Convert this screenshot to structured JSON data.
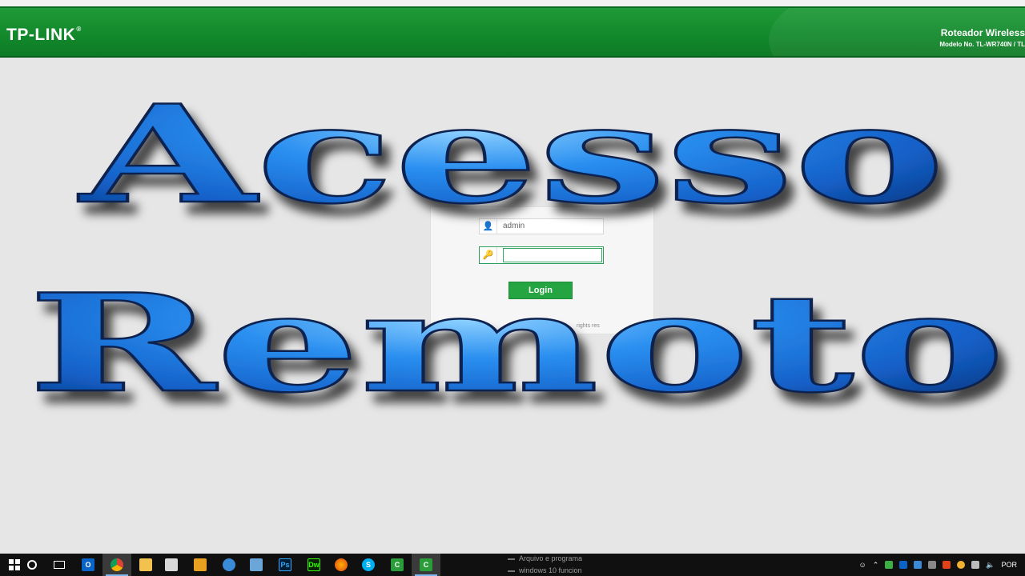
{
  "header": {
    "logo": "TP-LINK",
    "logo_mark": "®",
    "product_name": "Roteador Wireless",
    "model": "Modelo No. TL-WR740N / TL"
  },
  "login": {
    "username_value": "admin",
    "password_value": "",
    "button_label": "Login",
    "copyright_fragment": "rights res"
  },
  "overlay": {
    "line1": "Acesso",
    "line2": "Remoto"
  },
  "taskbar": {
    "apps": [
      "start",
      "cortana",
      "task-view",
      "outlook",
      "chrome",
      "file-explorer",
      "store",
      "media",
      "edge",
      "remote",
      "photoshop",
      "dreamweaver",
      "firefox",
      "skype",
      "camtasia",
      "camtasia-recorder"
    ],
    "search_suggestions": [
      "Arquivo e programa",
      "windows 10 funcion"
    ],
    "language": "POR"
  },
  "colors": {
    "header_green": "#138a2c",
    "button_green": "#25a542",
    "title_blue": "#1e7be0"
  }
}
